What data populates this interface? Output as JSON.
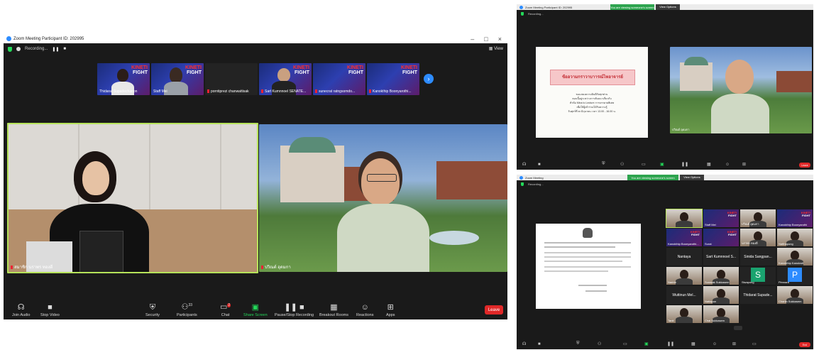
{
  "window_main": {
    "title": "Zoom Meeting Participant ID: 202995",
    "status": "Recording...",
    "view_label": "View",
    "participants_strip": [
      {
        "name": "Thidarat Supadechanon",
        "banner": [
          "KINETI",
          "FIGHT"
        ]
      },
      {
        "name": "Staff Mei",
        "banner": [
          "KINETI",
          "FIGHT"
        ]
      },
      {
        "name": "porntiprezi chanwattisak",
        "banner": []
      },
      {
        "name": "Sart Kumnnoel SENATE...",
        "banner": [
          "KINETI",
          "FIGHT"
        ]
      },
      {
        "name": "sunecrat ratngsomdo...",
        "banner": [
          "KINETI",
          "FIGHT"
        ]
      },
      {
        "name": "Kanokthip Boonyarothi...",
        "banner": [
          "KINETI",
          "FIGHT"
        ]
      }
    ],
    "speaker_left_name": "สมาชิก นราพร ทองดี",
    "speaker_right_name": "ปวิณต์ อุดมกา",
    "toolbar": [
      {
        "icon": "headphones-icon",
        "label": "Join Audio"
      },
      {
        "icon": "video-icon",
        "label": "Stop Video"
      },
      {
        "icon": "shield-icon",
        "label": "Security"
      },
      {
        "icon": "participants-icon",
        "label": "Participants",
        "count": "33"
      },
      {
        "icon": "chat-icon",
        "label": "Chat",
        "badge": "2"
      },
      {
        "icon": "share-icon",
        "label": "Share Screen"
      },
      {
        "icon": "record-icon",
        "label": "Pause/Stop Recording"
      },
      {
        "icon": "breakout-icon",
        "label": "Breakout Rooms"
      },
      {
        "icon": "reactions-icon",
        "label": "Reactions"
      },
      {
        "icon": "apps-icon",
        "label": "Apps"
      }
    ],
    "leave_label": "Leave"
  },
  "window_top_right": {
    "title": "Zoom Meeting Participant ID: 202995",
    "banner": "You are viewing someone's screen",
    "banner_option": "View Options",
    "status": "Recording...",
    "slide_title": "ข้ออวามกราวาบาารณ์ไหอาจารย์",
    "slide_lines": [
      "ขอแสดงความยินดีกับทุกท่าน",
      "ตอนนี้อยู่ระหว่างการสัมมนาเกี่ยวกับ",
      "หัวข้อ Mina to Lecture การบรรยายพิเศษ",
      "เพื่อให้ผู้เข้าร่วมได้รับความรู้",
      "วันศุกร์ที่ xx มิถุนายน เวลา 13.00 - 16.00 น."
    ],
    "speaker_name": "ปวิณต์ อุดมกา",
    "leave_label": "Leave"
  },
  "window_bottom_right": {
    "title": "Zoom Meeting",
    "banner": "You are viewing someone's screen",
    "banner_option": "View Options",
    "status": "Recording...",
    "grid": [
      {
        "name": "",
        "type": "video"
      },
      {
        "name": "Staff Mei",
        "type": "banner"
      },
      {
        "name": "ปวิณต์ อุดมกา",
        "type": "video"
      },
      {
        "name": "Kanokthip Boonyarothi",
        "type": "banner"
      },
      {
        "name": "Kanokthip Boonyarothi...",
        "type": "banner"
      },
      {
        "name": "Surat",
        "type": "banner"
      },
      {
        "name": "นราพร ทองดี",
        "type": "video"
      },
      {
        "name": "Natthapong",
        "type": "video"
      },
      {
        "name": "Nantaya",
        "type": "name"
      },
      {
        "name": "Sart Kumnnoel S...",
        "type": "name"
      },
      {
        "name": "Sinida Sangpan...",
        "type": "name"
      },
      {
        "name": "Kanokthip Kanokwit",
        "type": "video"
      },
      {
        "name": "Narintr",
        "type": "video"
      },
      {
        "name": "Surasak Sukkasem",
        "type": "video"
      },
      {
        "name": "Siwapong",
        "type": "initial",
        "letter": "S"
      },
      {
        "name": "Pimnara",
        "type": "initial",
        "letter": "P"
      },
      {
        "name": "Wuttinun Mel...",
        "type": "name"
      },
      {
        "name": "Nattapon",
        "type": "video"
      },
      {
        "name": "Thidarat Supade...",
        "type": "name"
      },
      {
        "name": "Chanin Sukkasem",
        "type": "video"
      },
      {
        "name": "Tanit",
        "type": "video"
      },
      {
        "name": "Chai Sukkasem",
        "type": "video"
      }
    ],
    "leave_label": "End"
  },
  "colors": {
    "zoom_blue": "#2d8cff",
    "leave_red": "#e02828",
    "active_speaker": "#b6e35a",
    "share_green": "#23d959"
  }
}
